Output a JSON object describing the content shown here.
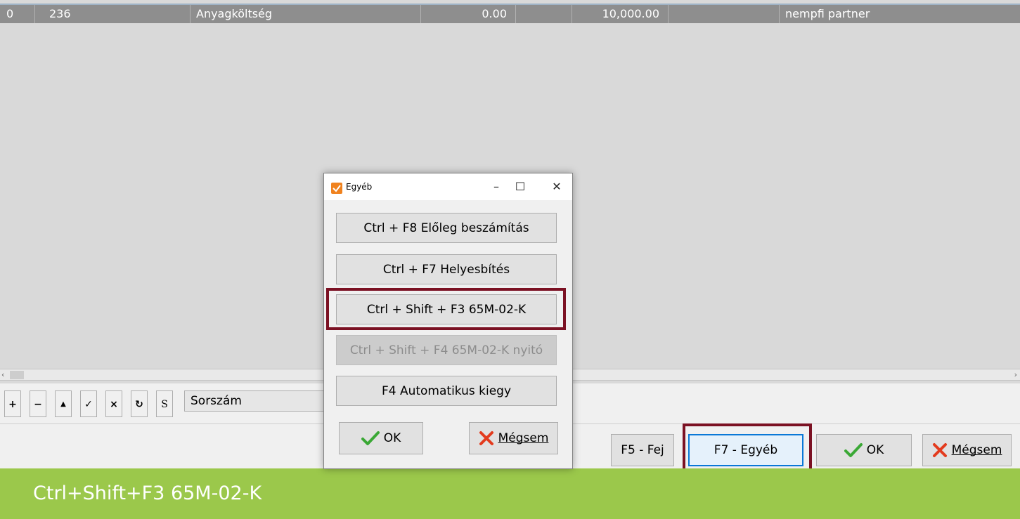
{
  "grid": {
    "row": [
      "0",
      "236",
      "Anyagköltség",
      "0.00",
      "",
      "10,000.00",
      "",
      "nempfi partner"
    ]
  },
  "scrollbar": {
    "left": "‹",
    "right": "›"
  },
  "toolbar": {
    "buttons": [
      "+",
      "−",
      "▲",
      "✓",
      "×",
      "↻",
      "S"
    ],
    "sort_field": "Sorszám"
  },
  "buttons": {
    "f5": "F5 - Fej",
    "f7": "F7 - Egyéb",
    "ok": "OK",
    "cancel": "Mégsem"
  },
  "dialog": {
    "title": "Egyéb",
    "items": [
      "Ctrl + F8 Előleg beszámítás",
      "Ctrl + F7 Helyesbítés",
      "Ctrl + Shift + F3 65M-02-K",
      "Ctrl + Shift + F4 65M-02-K nyitó",
      "F4 Automatikus kiegy"
    ],
    "ok": "OK",
    "cancel": "Mégsem"
  },
  "status": {
    "text": "Ctrl+Shift+F3 65M-02-K"
  },
  "colors": {
    "highlight": "#7b1123",
    "status_bg": "#9bc84b",
    "ok_green": "#3aa835",
    "cancel_red": "#e33b1e"
  }
}
